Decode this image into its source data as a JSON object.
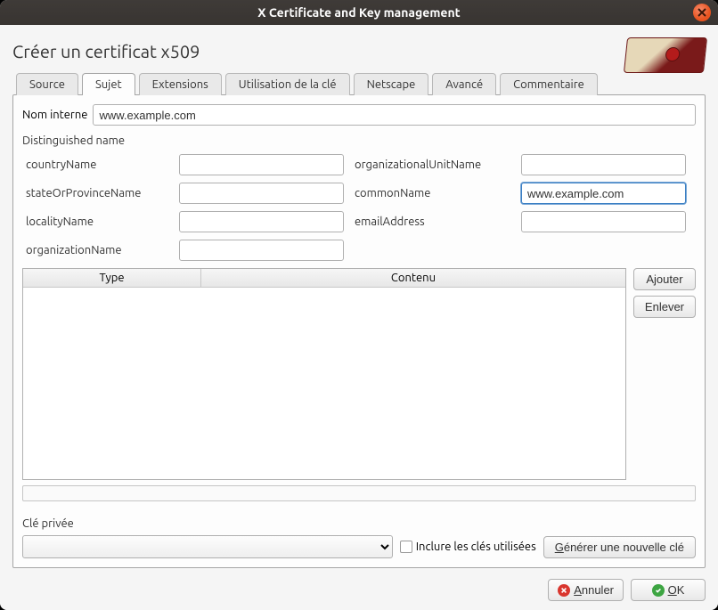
{
  "window": {
    "title": "X Certificate and Key management"
  },
  "page_title": "Créer un certificat x509",
  "tabs": [
    {
      "label": "Source"
    },
    {
      "label": "Sujet"
    },
    {
      "label": "Extensions"
    },
    {
      "label": "Utilisation de la clé"
    },
    {
      "label": "Netscape"
    },
    {
      "label": "Avancé"
    },
    {
      "label": "Commentaire"
    }
  ],
  "active_tab_index": 1,
  "internal_name": {
    "label": "Nom interne",
    "value": "www.example.com"
  },
  "dn": {
    "label": "Distinguished name",
    "fields": {
      "countryName": {
        "label": "countryName",
        "value": ""
      },
      "stateOrProvinceName": {
        "label": "stateOrProvinceName",
        "value": ""
      },
      "localityName": {
        "label": "localityName",
        "value": ""
      },
      "organizationName": {
        "label": "organizationName",
        "value": ""
      },
      "organizationalUnitName": {
        "label": "organizationalUnitName",
        "value": ""
      },
      "commonName": {
        "label": "commonName",
        "value": "www.example.com"
      },
      "emailAddress": {
        "label": "emailAddress",
        "value": ""
      }
    }
  },
  "table": {
    "headers": {
      "type": "Type",
      "content": "Contenu"
    },
    "buttons": {
      "add": "Ajouter",
      "remove": "Enlever"
    }
  },
  "private_key": {
    "label": "Clé privée",
    "selected": "",
    "include_used": "Inclure les clés utilisées",
    "generate": "Générer une nouvelle clé"
  },
  "footer": {
    "cancel": "Annuler",
    "ok": "OK"
  }
}
